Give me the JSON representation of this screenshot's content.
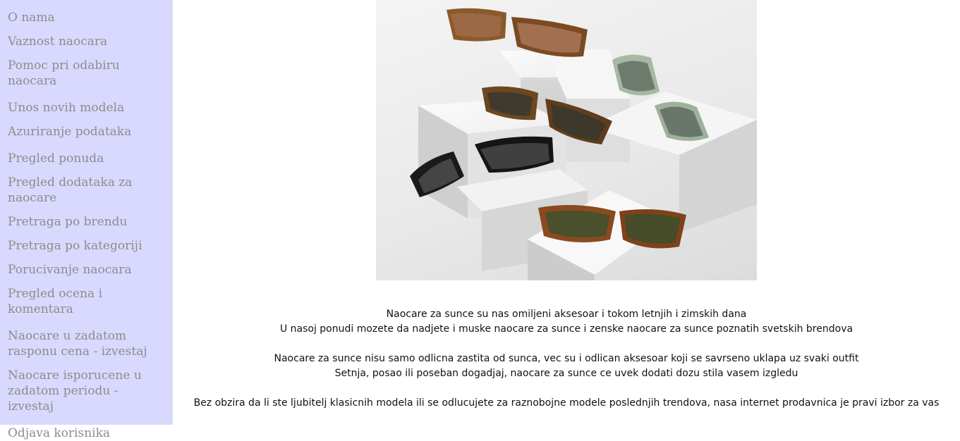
{
  "sidebar": {
    "groups": [
      {
        "items": [
          "O nama",
          "Vaznost naocara",
          "Pomoc pri odabiru naocara"
        ]
      },
      {
        "items": [
          "Unos novih modela",
          "Azuriranje podataka"
        ]
      },
      {
        "items": [
          "Pregled ponuda",
          "Pregled dodataka za naocare",
          "Pretraga po brendu",
          "Pretraga po kategoriji",
          "Porucivanje naocara",
          "Pregled ocena i komentara"
        ]
      },
      {
        "items": [
          "Naocare u zadatom rasponu cena - izvestaj",
          "Naocare isporucene u zadatom periodu - izvestaj"
        ]
      },
      {
        "items": [
          "Odjava korisnika"
        ]
      }
    ]
  },
  "main": {
    "hero_image": "sunglasses-on-white-blocks",
    "paragraphs": [
      [
        "Naocare za sunce su nas omiljeni aksesoar i tokom letnjih i zimskih dana",
        "U nasoj ponudi mozete da nadjete i muske naocare za sunce i zenske naocare za sunce poznatih svetskih brendova"
      ],
      [
        "Naocare za sunce nisu samo odlicna zastita od sunca, vec su i odlican aksesoar koji se savrseno uklapa uz svaki outfit",
        "Setnja, posao ili poseban dogadjaj, naocare za sunce ce uvek dodati dozu stila vasem izgledu"
      ],
      [
        "Bez obzira da li ste ljubitelj klasicnih modela ili se odlucujete za raznobojne modele poslednjih trendova, nasa internet prodavnica je pravi izbor za vas"
      ]
    ]
  }
}
